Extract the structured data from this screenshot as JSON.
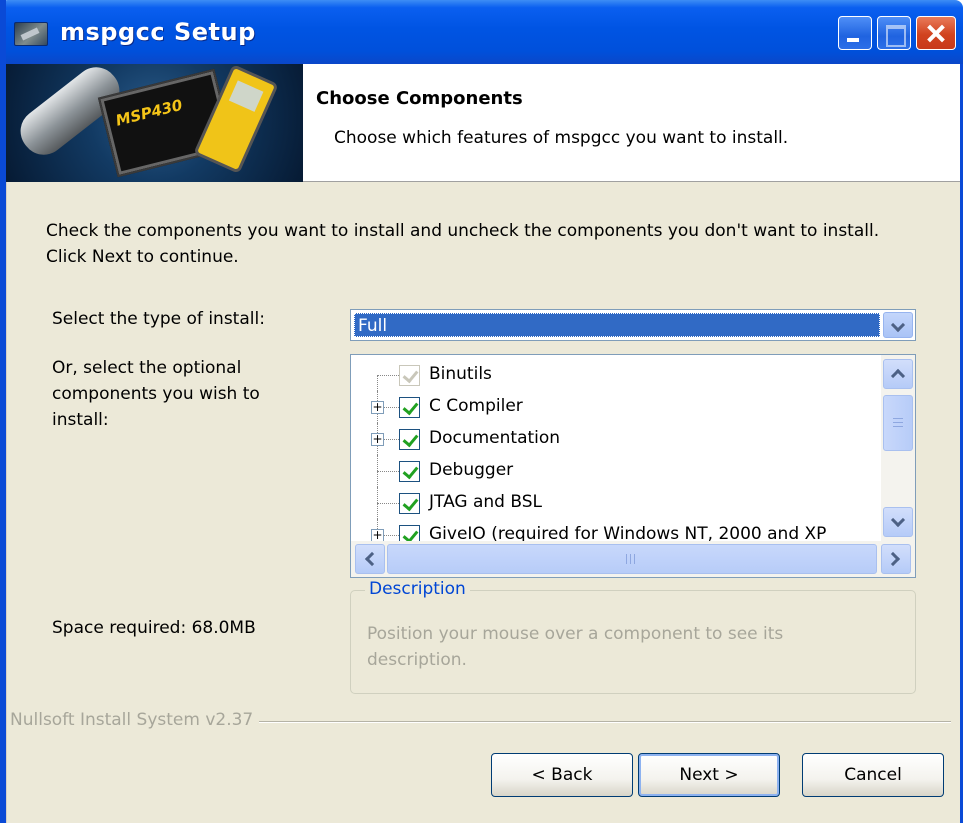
{
  "window": {
    "title": "mspgcc Setup",
    "icons": {
      "app": "installer-app-icon",
      "minimize": "minimize-icon",
      "maximize": "maximize-icon",
      "close": "close-icon"
    }
  },
  "header": {
    "title": "Choose Components",
    "subtitle": "Choose which features of mspgcc you want to install.",
    "image_chip_label": "MSP430"
  },
  "main": {
    "instruction": "Check the components you want to install and uncheck the components you don't want to install. Click Next to continue.",
    "install_type": {
      "label": "Select the type of install:",
      "selected": "Full"
    },
    "components": {
      "label": "Or, select the optional components you wish to install:",
      "items": [
        {
          "label": "Binutils",
          "checked": true,
          "disabled": true,
          "expandable": false
        },
        {
          "label": "C Compiler",
          "checked": true,
          "disabled": false,
          "expandable": true
        },
        {
          "label": "Documentation",
          "checked": true,
          "disabled": false,
          "expandable": true
        },
        {
          "label": "Debugger",
          "checked": true,
          "disabled": false,
          "expandable": false
        },
        {
          "label": "JTAG and BSL",
          "checked": true,
          "disabled": false,
          "expandable": false
        },
        {
          "label": "GiveIO (required for Windows NT, 2000 and XP",
          "checked": true,
          "disabled": false,
          "expandable": true
        }
      ]
    },
    "space_required": "Space required: 68.0MB",
    "description": {
      "legend": "Description",
      "text": "Position your mouse over a component to see its description."
    }
  },
  "footer": {
    "branding": "Nullsoft Install System v2.37",
    "back_label": "< Back",
    "next_label": "Next >",
    "cancel_label": "Cancel"
  },
  "colors": {
    "titlebar": "#0054e3",
    "body_bg": "#ece9d8",
    "selection": "#316ac5",
    "legend": "#0046d5",
    "check": "#21a121"
  }
}
